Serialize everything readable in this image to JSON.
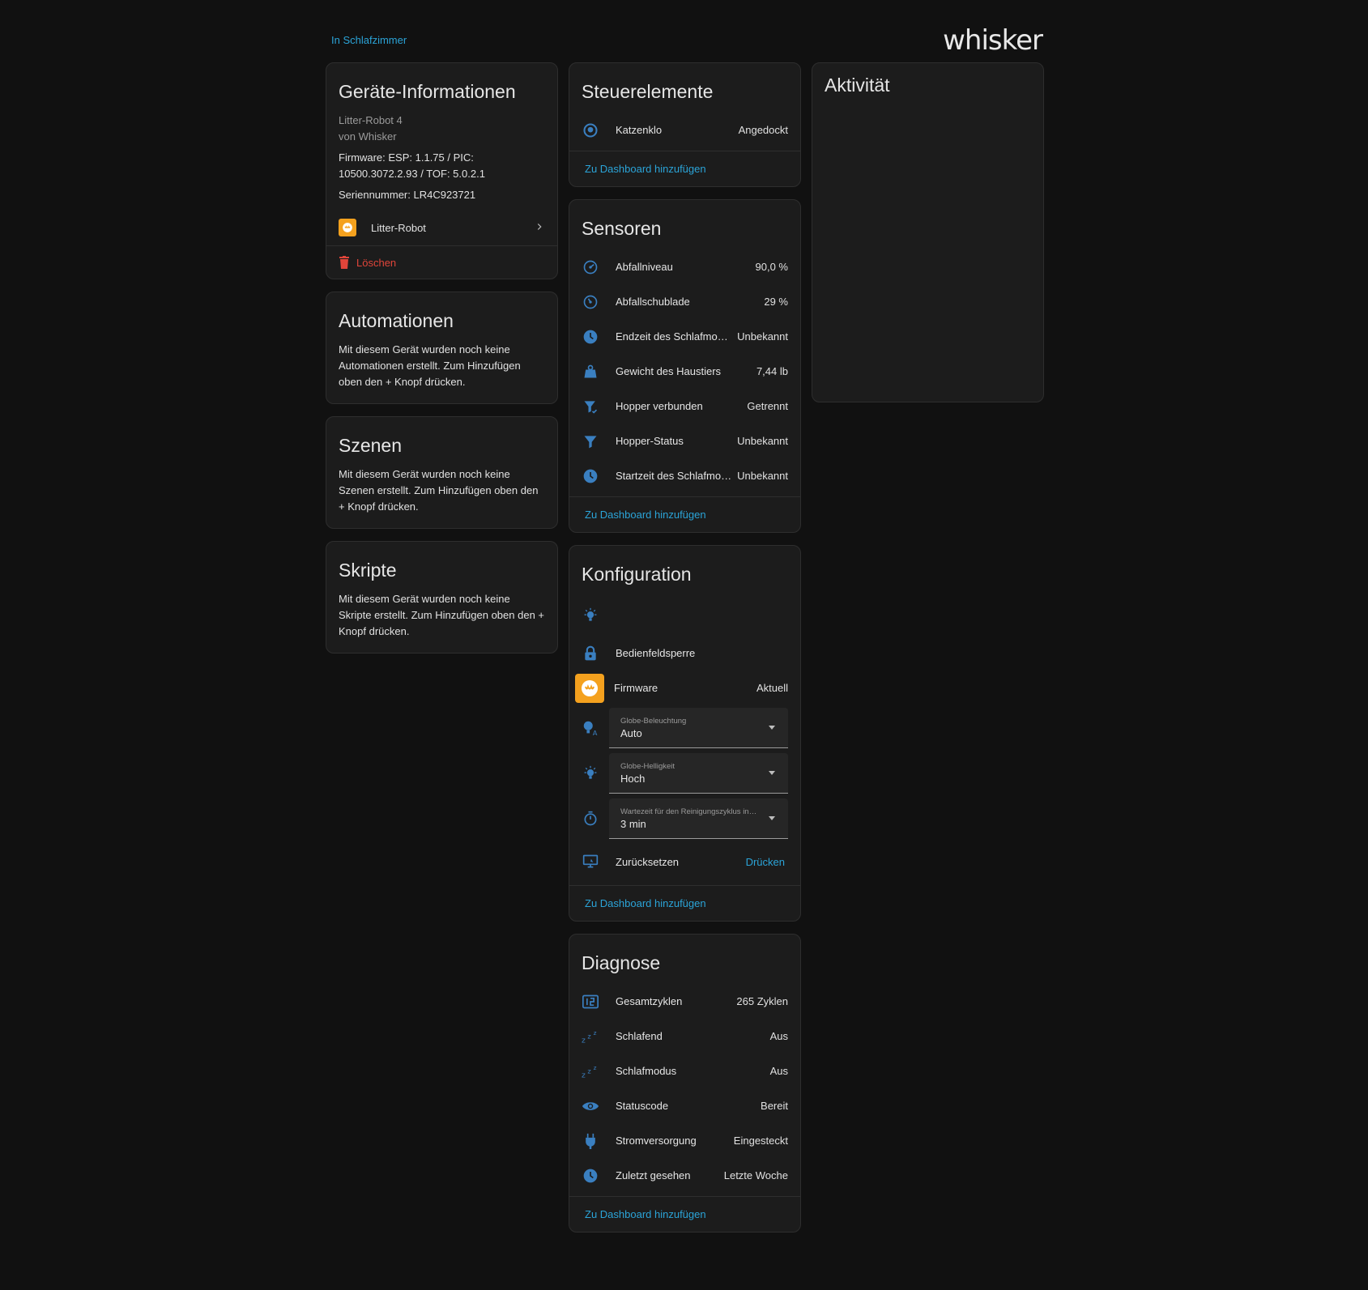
{
  "breadcrumb": {
    "link": "In Schlafzimmer"
  },
  "brand": {
    "logo_text": "whisker"
  },
  "device_info": {
    "title": "Geräte-Informationen",
    "model": "Litter-Robot 4",
    "manufacturer": "von Whisker",
    "firmware": "Firmware: ESP: 1.1.75 / PIC: 10500.3072.2.93 / TOF: 5.0.2.1",
    "serial": "Seriennummer: LR4C923721",
    "integration_label": "Litter-Robot",
    "delete_label": "Löschen"
  },
  "automations": {
    "title": "Automationen",
    "text": "Mit diesem Gerät wurden noch keine Automationen erstellt. Zum Hinzufügen oben den + Knopf drücken."
  },
  "scenes": {
    "title": "Szenen",
    "text": "Mit diesem Gerät wurden noch keine Szenen erstellt. Zum Hinzufügen oben den + Knopf drücken."
  },
  "scripts": {
    "title": "Skripte",
    "text": "Mit diesem Gerät wurden noch keine Skripte erstellt. Zum Hinzufügen oben den + Knopf drücken."
  },
  "controls": {
    "title": "Steuerelemente",
    "rows": [
      {
        "icon": "litter-box-icon",
        "label": "Katzenklo",
        "value": "Angedockt"
      }
    ],
    "add_link": "Zu Dashboard hinzufügen"
  },
  "sensors": {
    "title": "Sensoren",
    "rows": [
      {
        "icon": "gauge-icon",
        "label": "Abfallniveau",
        "value": "90,0 %"
      },
      {
        "icon": "gauge-icon",
        "label": "Abfallschublade",
        "value": "29 %"
      },
      {
        "icon": "clock-icon",
        "label": "Endzeit des Schlafmodus",
        "value": "Unbekannt"
      },
      {
        "icon": "weight-icon",
        "label": "Gewicht des Haustiers",
        "value": "7,44 lb"
      },
      {
        "icon": "funnel-check-icon",
        "label": "Hopper verbunden",
        "value": "Getrennt"
      },
      {
        "icon": "funnel-icon",
        "label": "Hopper-Status",
        "value": "Unbekannt"
      },
      {
        "icon": "clock-icon",
        "label": "Startzeit des Schlafmodus",
        "value": "Unbekannt"
      }
    ],
    "add_link": "Zu Dashboard hinzufügen"
  },
  "config": {
    "title": "Konfiguration",
    "rows_top": [
      {
        "icon": "lightbulb-icon",
        "label": "",
        "value": ""
      },
      {
        "icon": "lock-icon",
        "label": "Bedienfeldsperre",
        "value": ""
      }
    ],
    "firmware": {
      "label": "Firmware",
      "value": "Aktuell"
    },
    "selects": [
      {
        "icon": "lightbulb-auto-icon",
        "label": "Globe-Beleuchtung",
        "value": "Auto"
      },
      {
        "icon": "lightbulb-icon",
        "label": "Globe-Helligkeit",
        "value": "Hoch"
      },
      {
        "icon": "timer-icon",
        "label": "Wartezeit für den Reinigungszyklus in Minuten",
        "value": "3 min"
      }
    ],
    "reset": {
      "icon": "monitor-reset-icon",
      "label": "Zurücksetzen",
      "button": "Drücken"
    },
    "add_link": "Zu Dashboard hinzufügen"
  },
  "diagnostics": {
    "title": "Diagnose",
    "rows": [
      {
        "icon": "counter-icon",
        "label": "Gesamtzyklen",
        "value": "265 Zyklen"
      },
      {
        "icon": "sleep-icon",
        "label": "Schlafend",
        "value": "Aus"
      },
      {
        "icon": "sleep-icon",
        "label": "Schlafmodus",
        "value": "Aus"
      },
      {
        "icon": "eye-icon",
        "label": "Statuscode",
        "value": "Bereit"
      },
      {
        "icon": "power-plug-icon",
        "label": "Stromversorgung",
        "value": "Eingesteckt"
      },
      {
        "icon": "clock-icon",
        "label": "Zuletzt gesehen",
        "value": "Letzte Woche"
      }
    ],
    "add_link": "Zu Dashboard hinzufügen"
  },
  "activity": {
    "title": "Aktivität"
  },
  "colors": {
    "background": "#111111",
    "card": "#1c1c1c",
    "accent": "#2ba4d8",
    "icon": "#3a7fc0",
    "danger": "#e0453a",
    "brand_orange": "#f4a11e"
  }
}
